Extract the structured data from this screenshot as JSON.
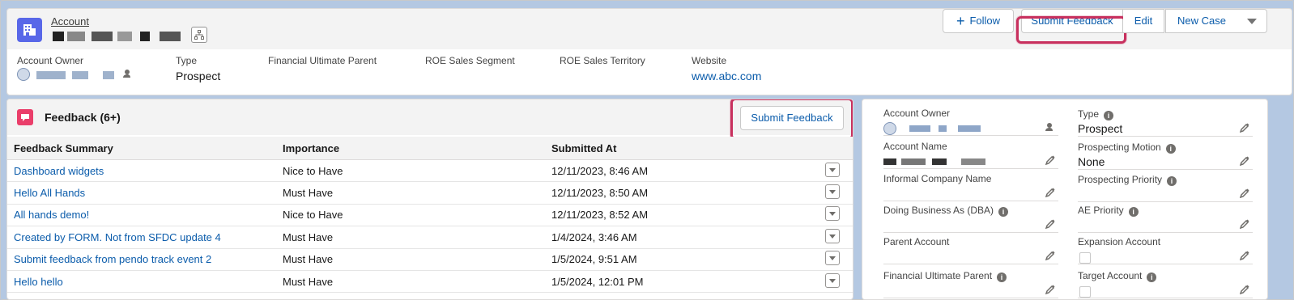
{
  "colors": {
    "brand": "#0b5cab",
    "highlight": "#c8305e",
    "objectIcon": "#5867e8",
    "feedbackIcon": "#ea3e6a"
  },
  "header": {
    "object_label": "Account",
    "icons": [
      "building-icon",
      "hierarchy-icon"
    ],
    "buttons": {
      "follow": "Follow",
      "submit_feedback": "Submit Feedback",
      "edit": "Edit",
      "new_case": "New Case"
    },
    "highlights": [
      {
        "label": "Account Owner",
        "value": ""
      },
      {
        "label": "Type",
        "value": "Prospect"
      },
      {
        "label": "Financial Ultimate Parent",
        "value": ""
      },
      {
        "label": "ROE Sales Segment",
        "value": ""
      },
      {
        "label": "ROE Sales Territory",
        "value": ""
      },
      {
        "label": "Website",
        "value": "www.abc.com"
      }
    ]
  },
  "related_list": {
    "title": "Feedback (6+)",
    "submit_label": "Submit Feedback",
    "columns": [
      "Feedback Summary",
      "Importance",
      "Submitted At"
    ],
    "rows": [
      {
        "summary": "Dashboard widgets",
        "importance": "Nice to Have",
        "submitted_at": "12/11/2023, 8:46 AM"
      },
      {
        "summary": "Hello All Hands",
        "importance": "Must Have",
        "submitted_at": "12/11/2023, 8:50 AM"
      },
      {
        "summary": "All hands demo!",
        "importance": "Nice to Have",
        "submitted_at": "12/11/2023, 8:52 AM"
      },
      {
        "summary": "Created by FORM. Not from SFDC update 4",
        "importance": "Must Have",
        "submitted_at": "1/4/2024, 3:46 AM"
      },
      {
        "summary": "Submit feedback from pendo track event 2",
        "importance": "Must Have",
        "submitted_at": "1/5/2024, 9:51 AM"
      },
      {
        "summary": "Hello hello",
        "importance": "Must Have",
        "submitted_at": "1/5/2024, 12:01 PM"
      }
    ]
  },
  "details": {
    "left": [
      {
        "label": "Account Owner",
        "value": ""
      },
      {
        "label": "Account Name",
        "value": ""
      },
      {
        "label": "Informal Company Name",
        "value": ""
      },
      {
        "label": "Doing Business As (DBA)",
        "value": ""
      },
      {
        "label": "Parent Account",
        "value": ""
      },
      {
        "label": "Financial Ultimate Parent",
        "value": ""
      }
    ],
    "right": [
      {
        "label": "Type",
        "value": "Prospect"
      },
      {
        "label": "Prospecting Motion",
        "value": "None"
      },
      {
        "label": "Prospecting Priority",
        "value": ""
      },
      {
        "label": "AE Priority",
        "value": ""
      },
      {
        "label": "Expansion Account",
        "value": ""
      },
      {
        "label": "Target Account",
        "value": ""
      }
    ]
  }
}
